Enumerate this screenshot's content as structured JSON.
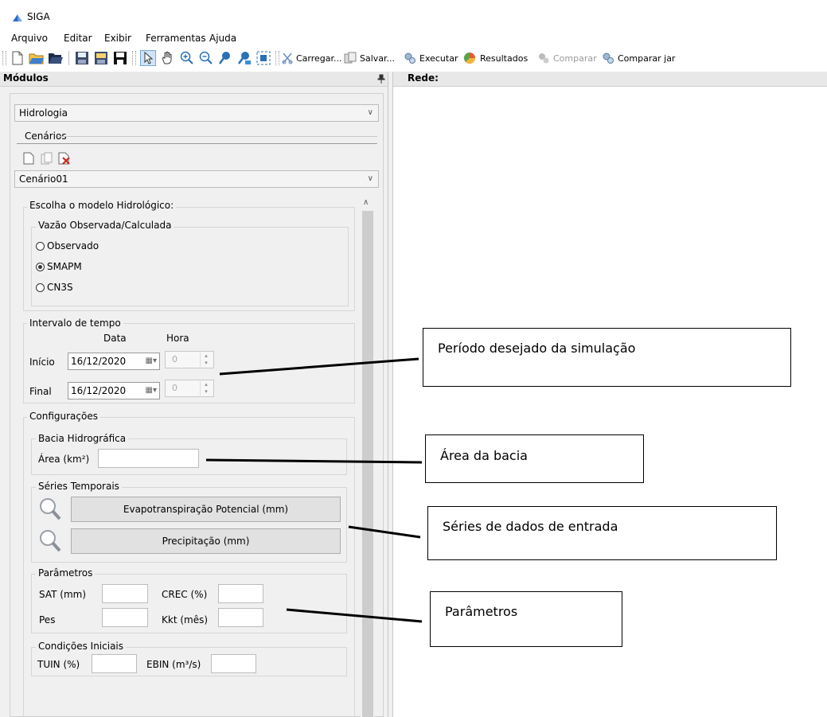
{
  "window": {
    "title": "SIGA"
  },
  "menu": [
    "Arquivo",
    "Editar",
    "Exibir",
    "Ferramentas",
    "Ajuda"
  ],
  "toolbar": {
    "icons": [
      "new-file-icon",
      "open-folder-icon",
      "open-folder-dark-icon",
      "save-disk-icon",
      "save-all-icon",
      "save-as-icon",
      "pointer-icon",
      "hand-pan-icon",
      "zoom-in-icon",
      "zoom-out-icon",
      "pin-a-icon",
      "pin-b-icon",
      "fit-extent-icon"
    ],
    "buttons": {
      "carregar": "Carregar...",
      "salvar": "Salvar...",
      "executar": "Executar",
      "resultados": "Resultados",
      "comparar": "Comparar",
      "comparar_jan": "Comparar jar"
    }
  },
  "modulos": {
    "title": "Módulos",
    "pin": "ᵖ",
    "module_select": "Hidrologia"
  },
  "rede": {
    "title": "Rede:"
  },
  "cenarios": {
    "label": "Cenários",
    "selected": "Cenário01"
  },
  "modelo": {
    "label": "Escolha o modelo Hidrológico:",
    "group_label": "Vazão Observada/Calculada",
    "options": [
      {
        "label": "Observado",
        "checked": false
      },
      {
        "label": "SMAPM",
        "checked": true
      },
      {
        "label": "CN3S",
        "checked": false
      }
    ]
  },
  "intervalo": {
    "label": "Intervalo de tempo",
    "col_data": "Data",
    "col_hora": "Hora",
    "inicio_label": "Início",
    "inicio_date": "16/12/2020",
    "inicio_hora": "0",
    "final_label": "Final",
    "final_date": "16/12/2020",
    "final_hora": "0"
  },
  "config": {
    "label": "Configurações",
    "bacia_label": "Bacia Hidrográfica",
    "area_label": "Área (km²)",
    "area_value": "",
    "series_label": "Séries Temporais",
    "evap_button": "Evapotranspiração Potencial (mm)",
    "precip_button": "Precipitação (mm)",
    "params_label": "Parâmetros",
    "sat_label": "SAT (mm)",
    "crec_label": "CREC (%)",
    "pes_label": "Pes",
    "kkt_label": "Kkt (mês)",
    "cond_label": "Condições Iniciais",
    "tuin_label": "TUIN (%)",
    "ebin_label": "EBIN (m³/s)"
  },
  "callouts": {
    "periodo": "Período desejado da simulação",
    "area": "Área da bacia",
    "series": "Séries de dados de entrada",
    "parametros": "Parâmetros"
  }
}
